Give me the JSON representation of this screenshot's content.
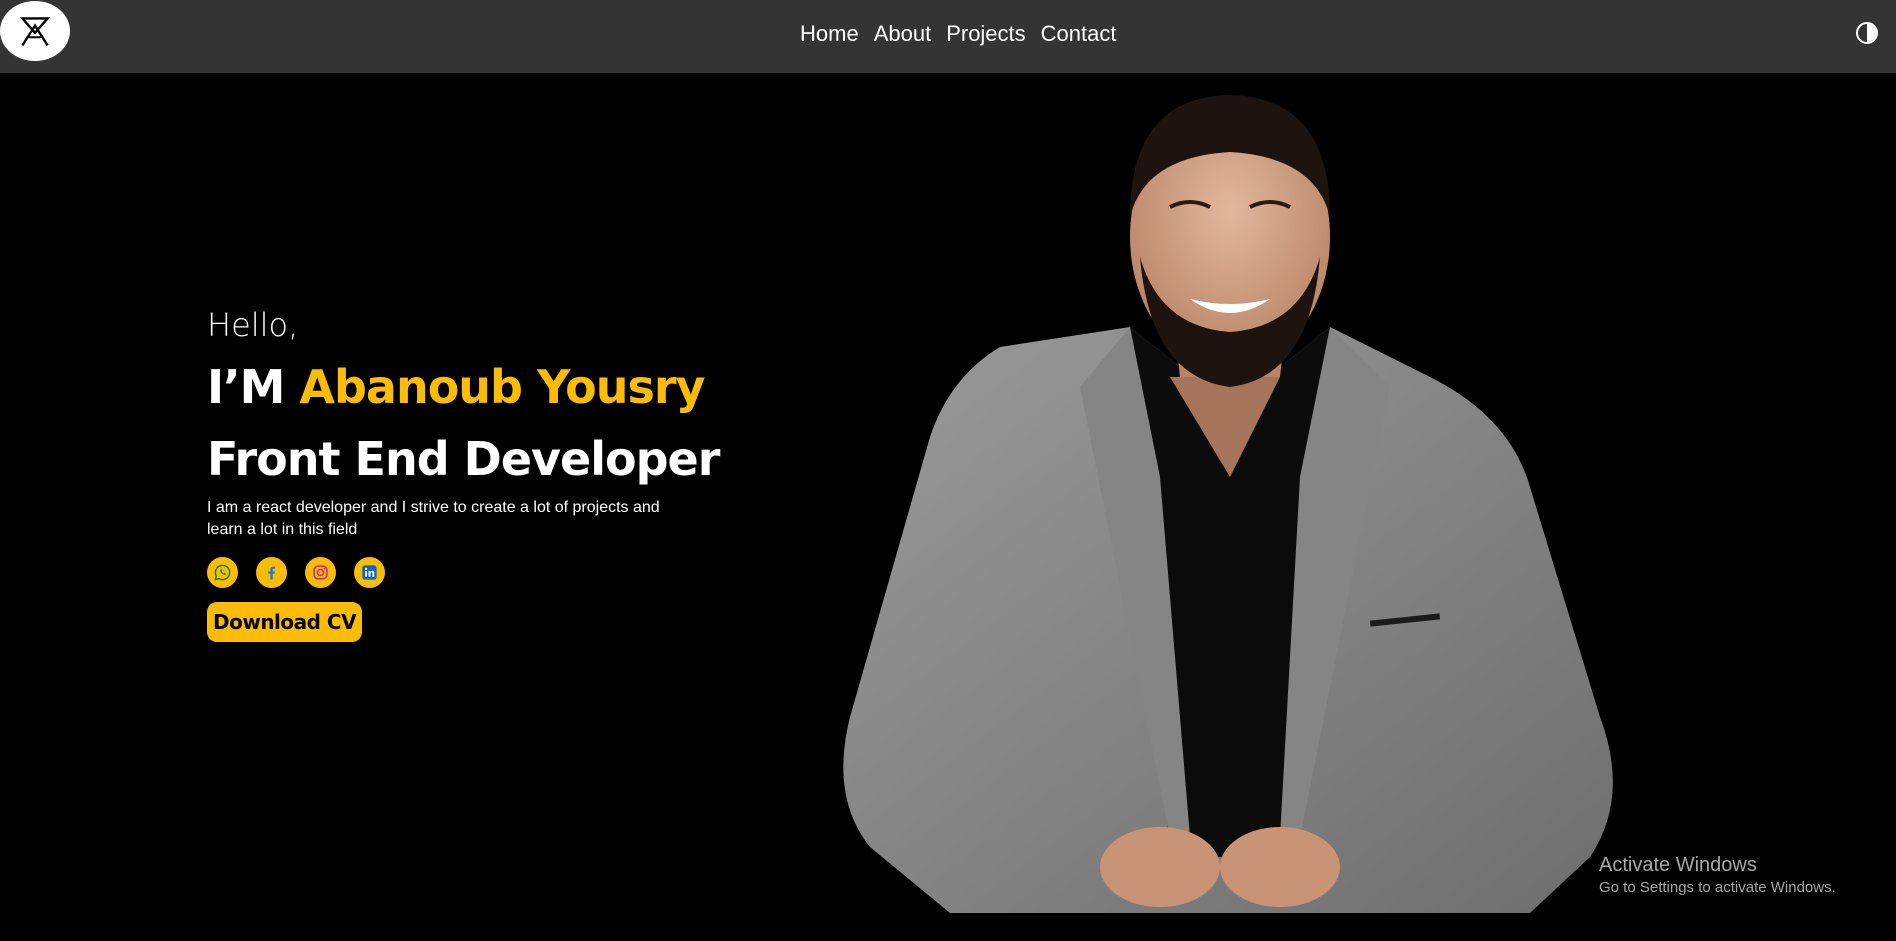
{
  "header": {
    "logo_icon": "aa-monogram-logo",
    "nav": [
      {
        "label": "Home"
      },
      {
        "label": "About"
      },
      {
        "label": "Projects"
      },
      {
        "label": "Contact"
      }
    ],
    "theme_toggle_icon": "contrast-icon"
  },
  "hero": {
    "greeting": "Hello,",
    "name_prefix": "I’M",
    "name": "Abanoub Yousry",
    "role": "Front End Developer",
    "bio": "I am a react developer and I strive to create a lot of projects and learn a lot in this field",
    "socials": [
      {
        "icon": "whatsapp-icon"
      },
      {
        "icon": "facebook-icon"
      },
      {
        "icon": "instagram-icon"
      },
      {
        "icon": "linkedin-icon"
      }
    ],
    "cv_button": "Download CV"
  },
  "watermark": {
    "title": "Activate Windows",
    "subtitle": "Go to Settings to activate Windows."
  },
  "colors": {
    "accent": "#fbbc05",
    "header_bg": "#343434",
    "page_bg": "#000000"
  }
}
